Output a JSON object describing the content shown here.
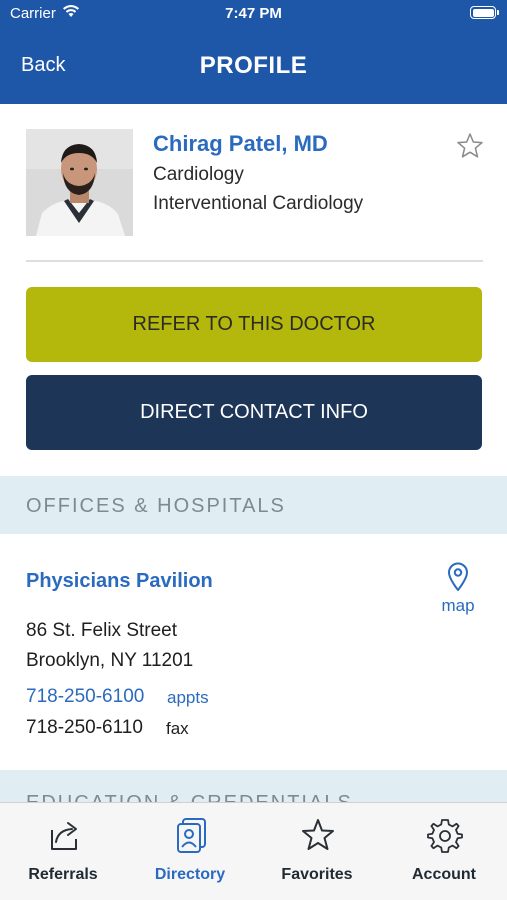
{
  "status_bar": {
    "carrier": "Carrier",
    "time": "7:47 PM"
  },
  "header": {
    "back_label": "Back",
    "title": "PROFILE"
  },
  "profile": {
    "name": "Chirag Patel, MD",
    "specialties": [
      "Cardiology",
      "Interventional Cardiology"
    ]
  },
  "actions": {
    "refer": "REFER TO THIS DOCTOR",
    "contact": "DIRECT CONTACT INFO"
  },
  "sections": {
    "offices": "OFFICES & HOSPITALS",
    "education": "EDUCATION & CREDENTIALS"
  },
  "office": {
    "name": "Physicians Pavilion",
    "map_label": "map",
    "address_line1": "86 St. Felix Street",
    "address_line2": "Brooklyn, NY 11201",
    "phone": "718-250-6100",
    "phone_tag": "appts",
    "fax": "718-250-6110",
    "fax_tag": "fax"
  },
  "tabs": [
    {
      "label": "Referrals",
      "icon": "share-icon",
      "active": false
    },
    {
      "label": "Directory",
      "icon": "directory-icon",
      "active": true
    },
    {
      "label": "Favorites",
      "icon": "star-icon",
      "active": false
    },
    {
      "label": "Account",
      "icon": "gear-icon",
      "active": false
    }
  ],
  "colors": {
    "header_bg": "#1f57a8",
    "link_blue": "#2a6bbf",
    "refer_bg": "#b5b80c",
    "contact_bg": "#1d3557",
    "section_bg": "#e0edf3"
  }
}
